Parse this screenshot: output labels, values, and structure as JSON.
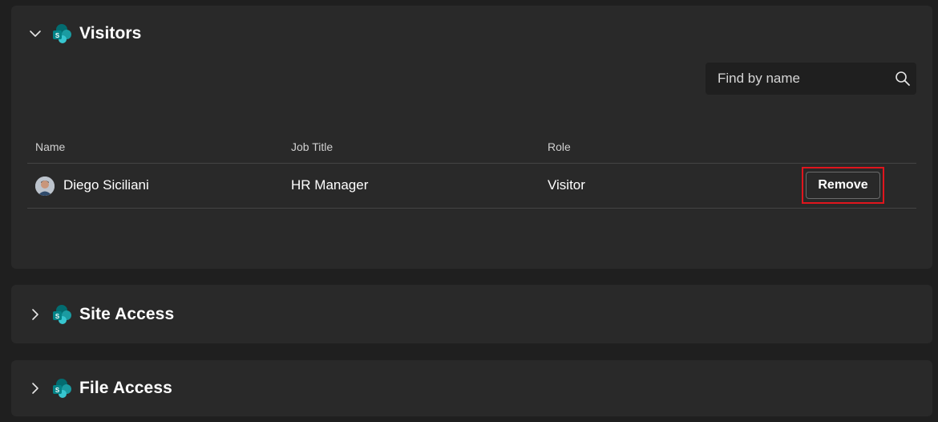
{
  "sections": {
    "visitors": {
      "title": "Visitors",
      "expanded": true
    },
    "site_access": {
      "title": "Site Access",
      "expanded": false
    },
    "file_access": {
      "title": "File Access",
      "expanded": false
    }
  },
  "search": {
    "placeholder": "Find by name",
    "value": ""
  },
  "table": {
    "headers": {
      "name": "Name",
      "job_title": "Job Title",
      "role": "Role"
    },
    "rows": [
      {
        "name": "Diego Siciliani",
        "job_title": "HR Manager",
        "role": "Visitor",
        "action": "Remove"
      }
    ]
  },
  "icons": {
    "expanded": "chevron-down-icon",
    "collapsed": "chevron-right-icon",
    "section": "sharepoint-icon",
    "search": "search-icon"
  },
  "colors": {
    "background": "#1f1f1f",
    "card": "#292929",
    "highlight": "#e0151d",
    "sharepoint_teal": "#1bb0b8"
  }
}
